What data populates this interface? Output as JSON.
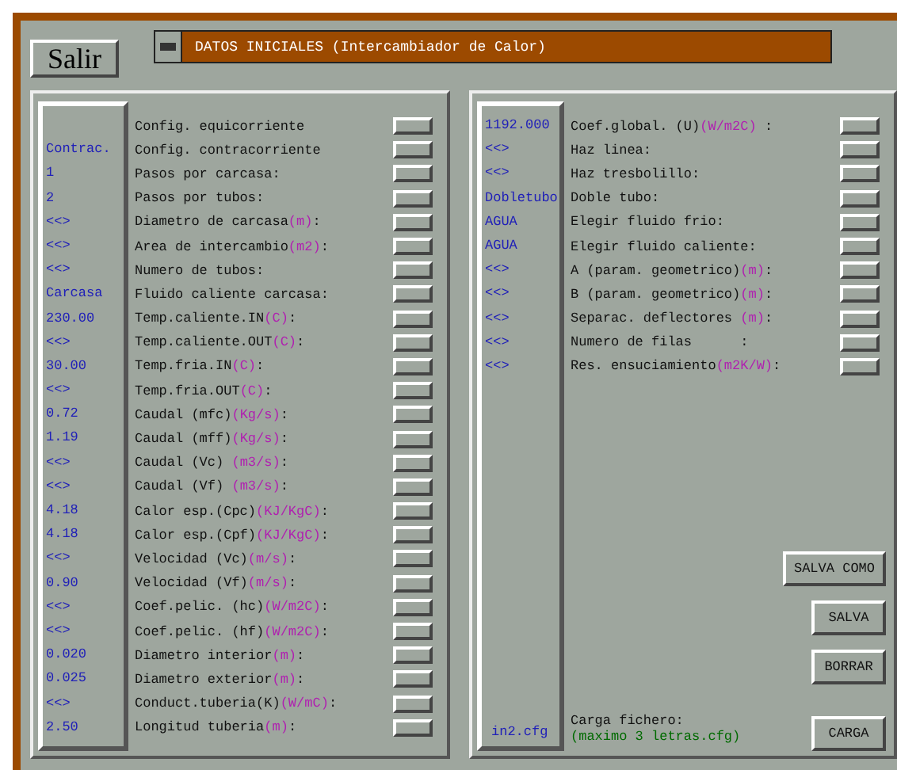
{
  "exit_button": "Salir",
  "window": {
    "title": "DATOS INICIALES (Intercambiador de Calor)"
  },
  "left_rows": [
    {
      "label": "Config. equicorriente"
    },
    {
      "value": "Contrac.",
      "label": "Config. contracorriente"
    },
    {
      "value": "1",
      "label": "Pasos por carcasa:"
    },
    {
      "value": "2",
      "label": "Pasos por tubos:"
    },
    {
      "value": "<<>",
      "label": "Diametro de carcasa",
      "unit": "(m)",
      "suffix": ":"
    },
    {
      "value": "<<>",
      "label": "Area de intercambio",
      "unit": "(m2)",
      "suffix": ":"
    },
    {
      "value": "<<>",
      "label": "Numero de tubos:"
    },
    {
      "value": "Carcasa",
      "label": "Fluido caliente carcasa:"
    },
    {
      "value": "230.00",
      "label": "Temp.caliente.IN",
      "unit": "(C)",
      "suffix": ":"
    },
    {
      "value": "<<>",
      "label": "Temp.caliente.OUT",
      "unit": "(C)",
      "suffix": ":"
    },
    {
      "value": "30.00",
      "label": "Temp.fria.IN",
      "unit": "(C)",
      "suffix": ":"
    },
    {
      "value": "<<>",
      "label": "Temp.fria.OUT",
      "unit": "(C)",
      "suffix": ":"
    },
    {
      "value": "0.72",
      "label": "Caudal (mfc)",
      "unit": "(Kg/s)",
      "suffix": ":"
    },
    {
      "value": "1.19",
      "label": "Caudal (mff)",
      "unit": "(Kg/s)",
      "suffix": ":"
    },
    {
      "value": "<<>",
      "label": "Caudal (Vc) ",
      "unit": "(m3/s)",
      "suffix": ":"
    },
    {
      "value": "<<>",
      "label": "Caudal (Vf) ",
      "unit": "(m3/s)",
      "suffix": ":"
    },
    {
      "value": "4.18",
      "label": "Calor esp.(Cpc)",
      "unit": "(KJ/KgC)",
      "suffix": ":"
    },
    {
      "value": "4.18",
      "label": "Calor esp.(Cpf)",
      "unit": "(KJ/KgC)",
      "suffix": ":"
    },
    {
      "value": "<<>",
      "label": "Velocidad (Vc)",
      "unit": "(m/s)",
      "suffix": ":"
    },
    {
      "value": "0.90",
      "label": "Velocidad (Vf)",
      "unit": "(m/s)",
      "suffix": ":"
    },
    {
      "value": "<<>",
      "label": "Coef.pelic. (hc)",
      "unit": "(W/m2C)",
      "suffix": ":"
    },
    {
      "value": "<<>",
      "label": "Coef.pelic. (hf)",
      "unit": "(W/m2C)",
      "suffix": ":"
    },
    {
      "value": "0.020",
      "label": "Diametro interior",
      "unit": "(m)",
      "suffix": ":"
    },
    {
      "value": "0.025",
      "label": "Diametro exterior",
      "unit": "(m)",
      "suffix": ":"
    },
    {
      "value": "<<>",
      "label": "Conduct.tuberia(K)",
      "unit": "(W/mC)",
      "suffix": ":"
    },
    {
      "value": "2.50",
      "label": "Longitud tuberia",
      "unit": "(m)",
      "suffix": ":"
    }
  ],
  "right_rows": [
    {
      "value": "1192.000",
      "label": "Coef.global. (U)",
      "unit": "(W/m2C)",
      "suffix": " :"
    },
    {
      "value": "<<>",
      "label": "Haz linea:"
    },
    {
      "value": "<<>",
      "label": "Haz tresbolillo:"
    },
    {
      "value": "Dobletubo",
      "label": "Doble tubo:"
    },
    {
      "value": "AGUA",
      "label": "Elegir fluido frio:"
    },
    {
      "value": "AGUA",
      "label": "Elegir fluido caliente:"
    },
    {
      "value": "<<>",
      "label": "A (param. geometrico)",
      "unit": "(m)",
      "suffix": ":"
    },
    {
      "value": "<<>",
      "label": "B (param. geometrico)",
      "unit": "(m)",
      "suffix": ":"
    },
    {
      "value": "<<>",
      "label": "Separac. deflectores ",
      "unit": "(m)",
      "suffix": ":"
    },
    {
      "value": "<<>",
      "label": "Numero de filas      :"
    },
    {
      "value": "<<>",
      "label": "Res. ensuciamiento",
      "unit": "(m2K/W)",
      "suffix": ":"
    }
  ],
  "actions": [
    "SALVA COMO",
    "SALVA",
    "BORRAR"
  ],
  "file": {
    "value": "in2.cfg",
    "label": "Carga fichero:",
    "hint": "(maximo 3 letras.cfg)",
    "button": "CARGA"
  }
}
